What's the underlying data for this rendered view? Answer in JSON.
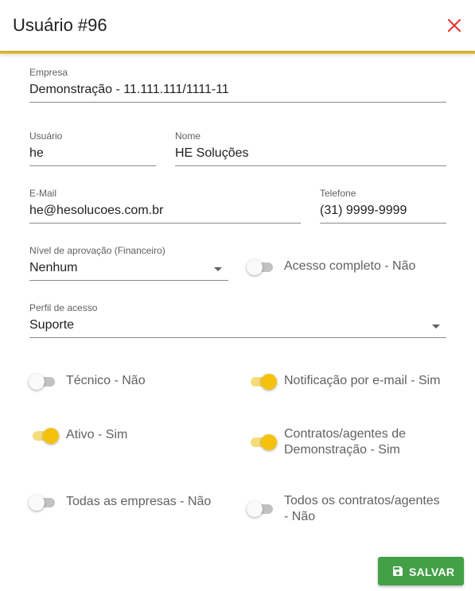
{
  "dialog": {
    "title": "Usuário #96"
  },
  "fields": {
    "empresa": {
      "label": "Empresa",
      "value": "Demonstração - 11.111.111/1111-11"
    },
    "usuario": {
      "label": "Usuário",
      "value": "he"
    },
    "nome": {
      "label": "Nome",
      "value": "HE Soluções"
    },
    "email": {
      "label": "E-Mail",
      "value": "he@hesolucoes.com.br"
    },
    "telefone": {
      "label": "Telefone",
      "value": "(31) 9999-9999"
    },
    "nivel_aprovacao": {
      "label": "Nível de aprovação (Financeiro)",
      "value": "Nenhum"
    },
    "perfil_acesso": {
      "label": "Perfil de acesso",
      "value": "Suporte"
    }
  },
  "toggles": {
    "acesso_completo": {
      "label": "Acesso completo - Não",
      "on": false
    },
    "tecnico": {
      "label": "Técnico - Não",
      "on": false
    },
    "notificacao_email": {
      "label": "Notificação por e-mail - Sim",
      "on": true
    },
    "ativo": {
      "label": "Ativo - Sim",
      "on": true
    },
    "contratos_agentes_demo": {
      "label_line1": "Contratos/agentes de",
      "label_line2": "Demonstração - Sim",
      "on": true
    },
    "todas_empresas": {
      "label": "Todas as empresas - Não",
      "on": false
    },
    "todos_contratos": {
      "label_line1": "Todos os contratos/agentes",
      "label_line2": "- Não",
      "on": false
    }
  },
  "actions": {
    "save_label": "SALVAR",
    "save_icon": "save-icon",
    "close_icon": "close-icon"
  },
  "colors": {
    "accent": "#f4c20d",
    "close": "#e53935",
    "save": "#43a047"
  }
}
